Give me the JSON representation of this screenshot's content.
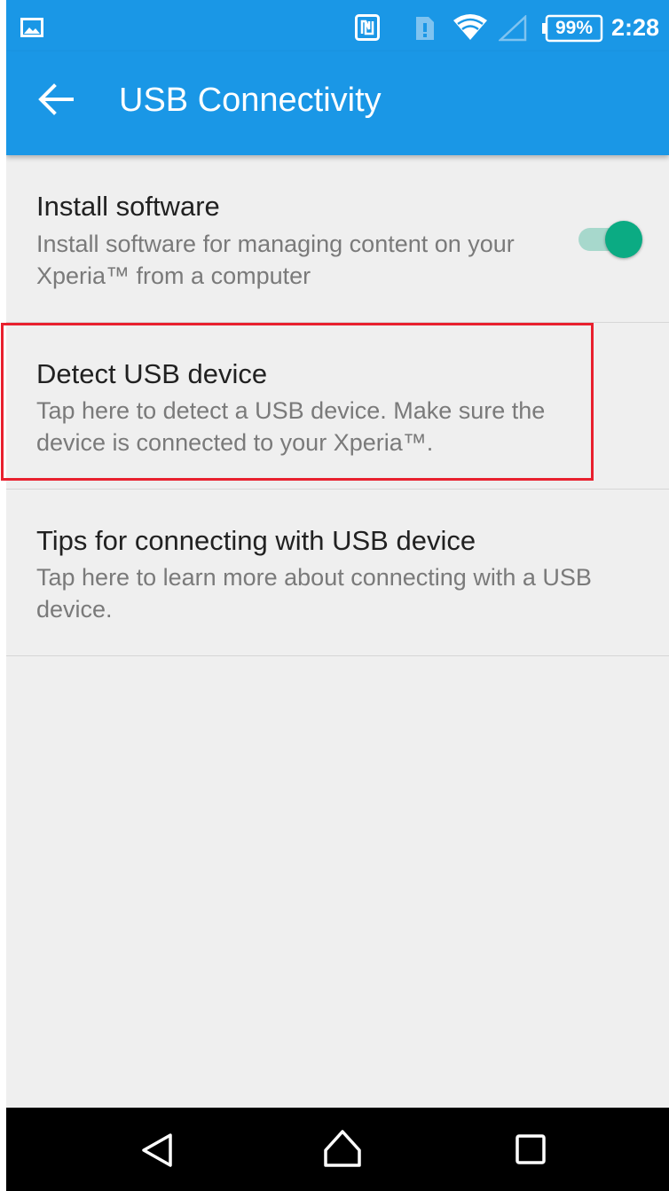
{
  "status_bar": {
    "icons": [
      "gallery-icon",
      "nfc-icon",
      "sim-card-icon",
      "wifi-icon",
      "signal-icon",
      "battery-icon"
    ],
    "battery": "99%",
    "time": "2:28"
  },
  "app_bar": {
    "back_icon": "arrow-left-icon",
    "title": "USB Connectivity"
  },
  "settings": [
    {
      "title": "Install software",
      "summary": "Install software for managing content on your Xperia™ from a computer",
      "toggle_on": true
    },
    {
      "title": "Detect USB device",
      "summary": "Tap here to detect a USB device. Make sure the device is connected to your Xperia™."
    },
    {
      "title": "Tips for connecting with USB device",
      "summary": "Tap here to learn more about connecting with a USB device."
    }
  ],
  "nav_bar": {
    "icons": [
      "nav-back-icon",
      "nav-home-icon",
      "nav-recents-icon"
    ]
  },
  "colors": {
    "primary": "#1a97e6",
    "background": "#efefef",
    "toggle_on": "#0bab83",
    "highlight": "#e8202e"
  }
}
